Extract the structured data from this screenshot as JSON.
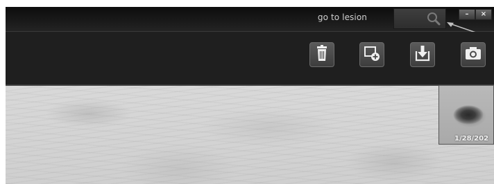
{
  "header": {
    "goto_label": "go to lesion",
    "goto_value": "",
    "window_controls": {
      "minimize_label": "–",
      "close_label": "×"
    }
  },
  "toolbar": {
    "buttons": [
      {
        "name": "delete",
        "icon": "trash-icon"
      },
      {
        "name": "add-region",
        "icon": "add-box-icon"
      },
      {
        "name": "import",
        "icon": "download-tray-icon"
      },
      {
        "name": "capture",
        "icon": "camera-icon"
      }
    ]
  },
  "thumbnail": {
    "date": "1/28/202"
  },
  "colors": {
    "titlebar": "#151515",
    "toolbar": "#1f1f1f",
    "button": "#4a4a4a",
    "viewer": "#d4d4d4"
  }
}
